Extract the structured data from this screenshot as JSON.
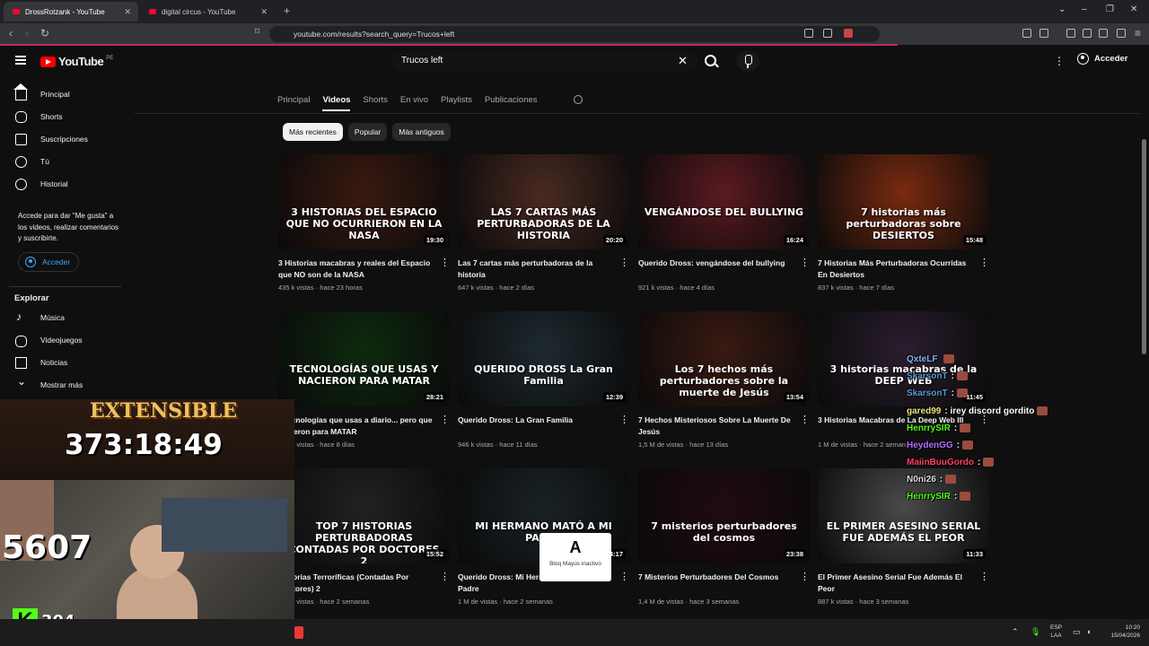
{
  "browser": {
    "tabs": [
      {
        "title": "DrossRotzank - YouTube",
        "active": true
      },
      {
        "title": "digital circus - YouTube",
        "active": false
      }
    ],
    "url": "youtube.com/results?search_query=Trucos+left"
  },
  "header": {
    "logo_text": "YouTube",
    "country_code": "PE",
    "search_value": "Trucos left",
    "signin_label": "Acceder"
  },
  "sidebar": {
    "items": [
      {
        "label": "Principal",
        "icon": "home-icon"
      },
      {
        "label": "Shorts",
        "icon": "shorts-icon"
      },
      {
        "label": "Suscripciones",
        "icon": "subscriptions-icon"
      },
      {
        "label": "Tú",
        "icon": "user-icon"
      },
      {
        "label": "Historial",
        "icon": "history-icon"
      }
    ],
    "signin_note": "Accede para dar \"Me gusta\" a los videos, realizar comentarios y suscribirte.",
    "signin_label": "Acceder",
    "explore_title": "Explorar",
    "explore_items": [
      {
        "label": "Música",
        "icon": "music-icon"
      },
      {
        "label": "Videojuegos",
        "icon": "gaming-icon"
      },
      {
        "label": "Noticias",
        "icon": "news-icon"
      },
      {
        "label": "Mostrar más",
        "icon": "chevron-down-icon"
      }
    ]
  },
  "channel_tabs": [
    "Principal",
    "Videos",
    "Shorts",
    "En vivo",
    "Playlists",
    "Publicaciones"
  ],
  "active_tab": "Videos",
  "chips": [
    "Más recientes",
    "Popular",
    "Más antiguos"
  ],
  "active_chip": "Más recientes",
  "videos": [
    {
      "title": "3 Historias macabras y reales del Espacio que NO son de la NASA",
      "views": "435 k vistas",
      "age": "hace 23 horas",
      "duration": "19:30",
      "thumb_text": "3 HISTORIAS DEL ESPACIO QUE NO OCURRIERON EN LA NASA",
      "color": "#3a1a10"
    },
    {
      "title": "Las 7 cartas más perturbadoras de la historia",
      "views": "647 k vistas",
      "age": "hace 2 días",
      "duration": "20:20",
      "thumb_text": "LAS 7 CARTAS MÁS PERTURBADORAS DE LA HISTORIA",
      "color": "#4a2a22"
    },
    {
      "title": "Querido Dross: vengándose del bullying",
      "views": "921 k vistas",
      "age": "hace 4 días",
      "duration": "16:24",
      "thumb_text": "VENGÁNDOSE DEL BULLYING",
      "color": "#5a1a20"
    },
    {
      "title": "7 Historias Más Perturbadoras Ocurridas En Desiertos",
      "views": "837 k vistas",
      "age": "hace 7 días",
      "duration": "15:48",
      "thumb_text": "7 historias más perturbadoras sobre DESIERTOS",
      "color": "#7a2a10"
    },
    {
      "title": "7 tecnologías que usas a diario... pero que nacieron para MATAR",
      "views": "670 k vistas",
      "age": "hace 8 días",
      "duration": "28:21",
      "thumb_text": "TECNOLOGÍAS QUE USAS Y NACIERON PARA MATAR",
      "color": "#0e2a0e"
    },
    {
      "title": "Querido Dross: La Gran Familia",
      "views": "946 k vistas",
      "age": "hace 11 días",
      "duration": "12:39",
      "thumb_text": "QUERIDO DROSS La Gran Familia",
      "color": "#1e2a30"
    },
    {
      "title": "7 Hechos Misteriosos Sobre La Muerte De Jesús",
      "views": "1,5 M de vistas",
      "age": "hace 13 días",
      "duration": "13:54",
      "thumb_text": "Los 7 hechos más perturbadores sobre la muerte de Jesús",
      "color": "#3a1a12"
    },
    {
      "title": "3 Historias Macabras de La Deep Web III",
      "views": "1 M de vistas",
      "age": "hace 2 semanas",
      "duration": "11:45",
      "thumb_text": "3 historias macabras de la DEEP WEB",
      "color": "#2a1e2e"
    },
    {
      "title": "Historias Terroríficas (Contadas Por Doctores) 2",
      "views": "870 k vistas",
      "age": "hace 2 semanas",
      "duration": "15:52",
      "thumb_text": "TOP 7 HISTORIAS PERTURBADORAS CONTADAS POR DOCTORES 2",
      "color": "#222222"
    },
    {
      "title": "Querido Dross: Mi Hermano Mató A Mi Padre",
      "views": "1 M de vistas",
      "age": "hace 2 semanas",
      "duration": "14:17",
      "thumb_text": "MI HERMANO MATÓ A MI PADRE",
      "color": "#1a2226"
    },
    {
      "title": "7 Misterios Perturbadores Del Cosmos",
      "views": "1,4 M de vistas",
      "age": "hace 3 semanas",
      "duration": "23:38",
      "thumb_text": "7 misterios perturbadores del cosmos",
      "color": "#200a14"
    },
    {
      "title": "El Primer Asesino Serial Fue Además El Peor",
      "views": "887 k vistas",
      "age": "hace 3 semanas",
      "duration": "11:33",
      "thumb_text": "EL PRIMER ASESINO SERIAL FUE ADEMÁS EL PEOR",
      "color": "#4a4a4a"
    }
  ],
  "overlay": {
    "timer_label": "EXTENSIBLE",
    "timer_value": "373:18:49",
    "counter_big": "5607",
    "kick_count": "304",
    "caps_lock_text": "Bloq Mayús inactivo",
    "chat": [
      {
        "user": "QxteLF",
        "msg": "",
        "color": "#8ab4f8"
      },
      {
        "user": "SkarsonT",
        "msg": ":",
        "color": "#5b9bd5"
      },
      {
        "user": "SkarsonT",
        "msg": ":",
        "color": "#5b9bd5"
      },
      {
        "user": "gared99",
        "msg": ": irey discord gordito",
        "color": "#f0e080"
      },
      {
        "user": "HenrrySIR",
        "msg": ":",
        "color": "#53fc18"
      },
      {
        "user": "HeydenGG",
        "msg": ":",
        "color": "#b070ff"
      },
      {
        "user": "MaiinBuuGordo",
        "msg": ":",
        "color": "#ff4060"
      },
      {
        "user": "N0ni26",
        "msg": ":",
        "color": "#dddddd"
      },
      {
        "user": "HenrrySIR",
        "msg": ":",
        "color": "#53fc18"
      }
    ]
  },
  "taskbar": {
    "lang_top": "ESP",
    "lang_bottom": "LAA",
    "time": "10:20",
    "date": "15/04/2026"
  }
}
